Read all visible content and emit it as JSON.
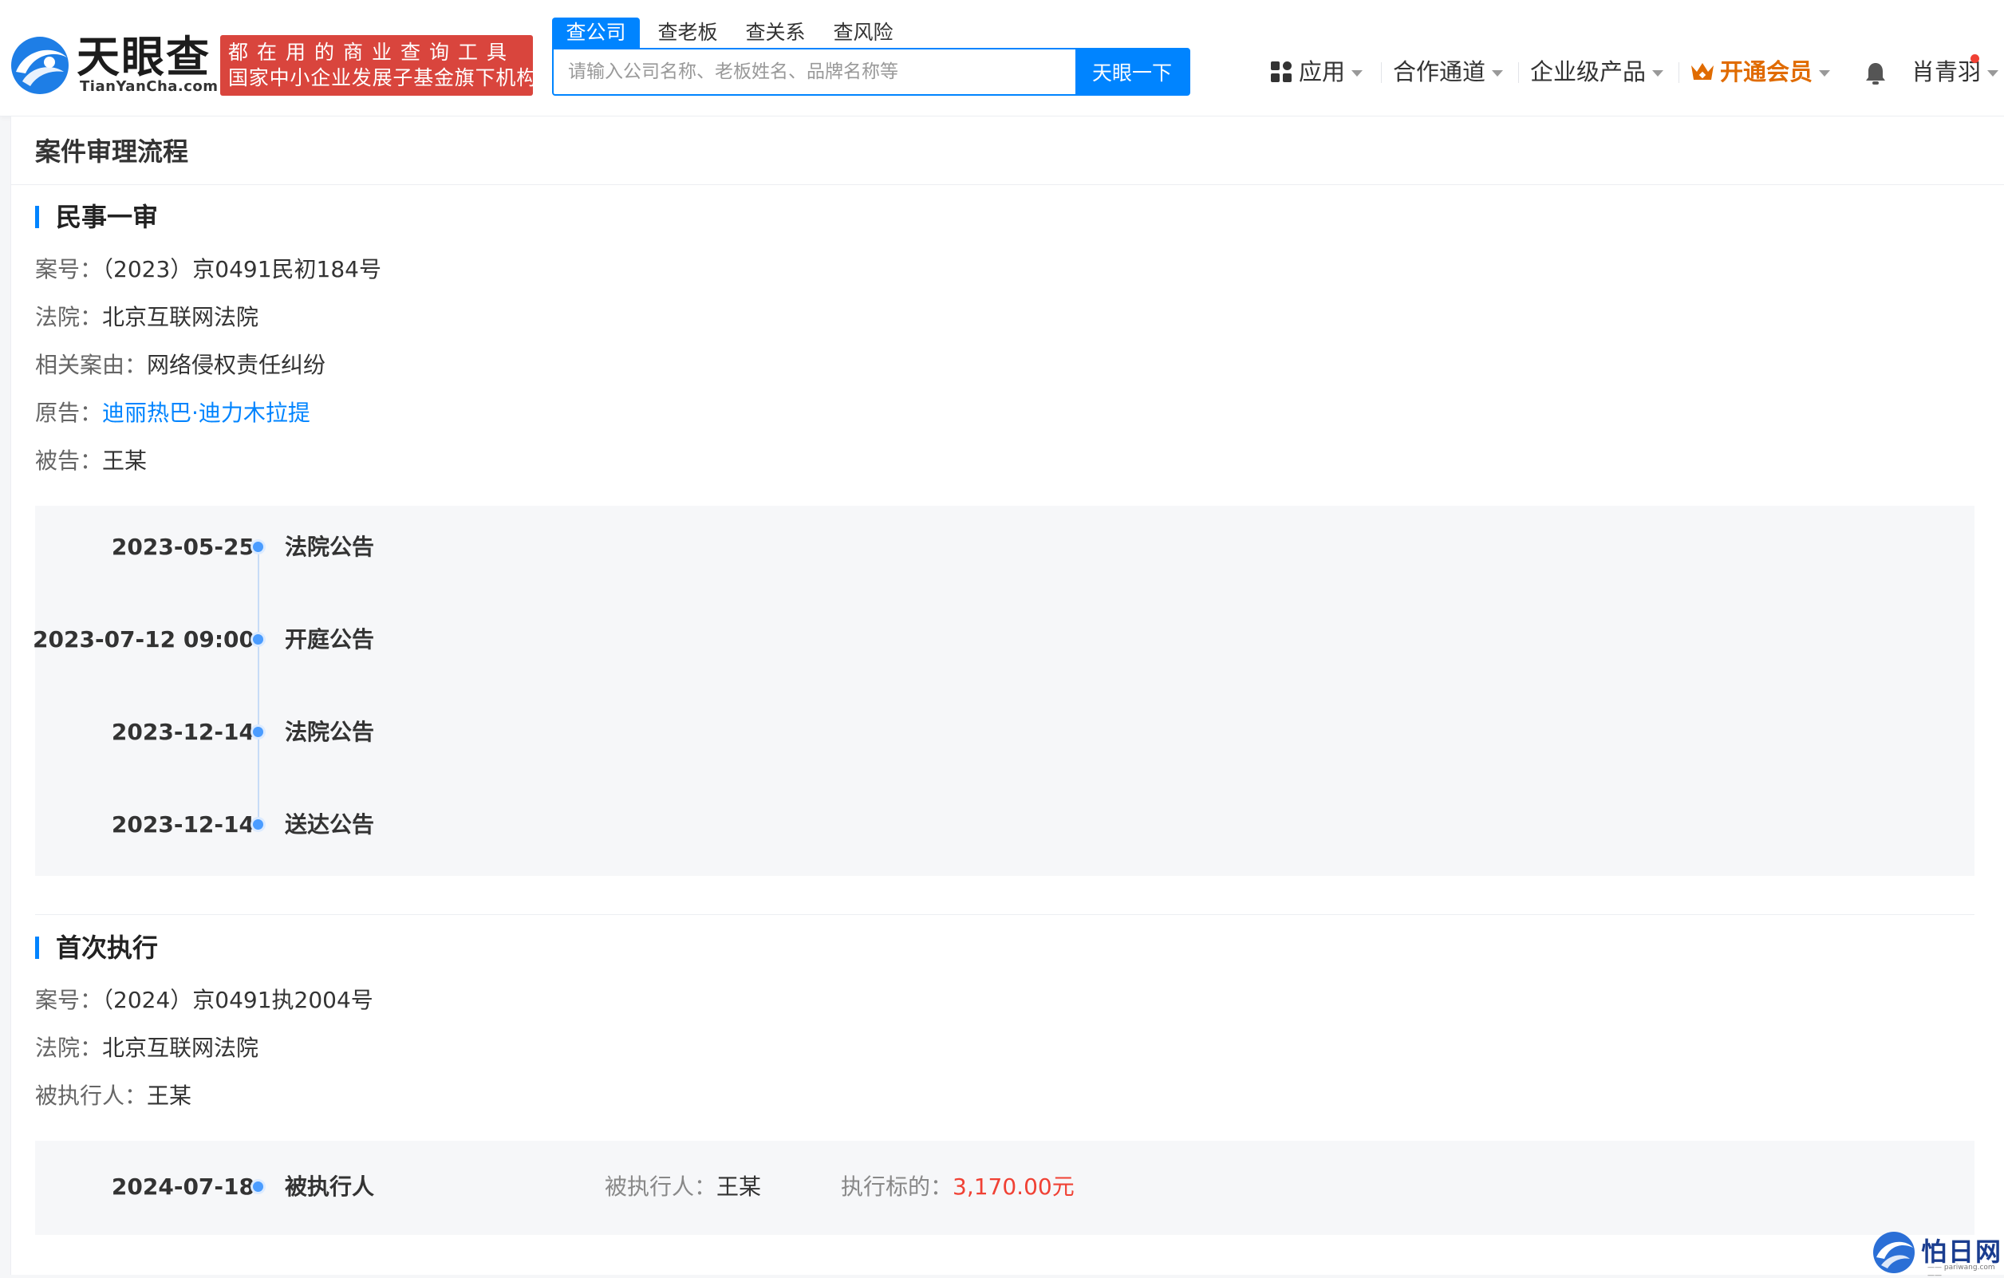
{
  "header": {
    "logo_cn": "天眼查",
    "logo_en": "TianYanCha.com",
    "slogan_line1": "都在用的商业查询工具",
    "slogan_line2": "国家中小企业发展子基金旗下机构",
    "search_tabs": [
      "查公司",
      "查老板",
      "查关系",
      "查风险"
    ],
    "search_placeholder": "请输入公司名称、老板姓名、品牌名称等",
    "search_button": "天眼一下",
    "nav": {
      "apps": "应用",
      "cooperation": "合作通道",
      "enterprise": "企业级产品",
      "vip": "开通会员",
      "user": "肖青羽"
    }
  },
  "page": {
    "title": "案件审理流程"
  },
  "civil_first_instance": {
    "title": "民事一审",
    "case_no_label": "案号：",
    "case_no": "（2023）京0491民初184号",
    "court_label": "法院：",
    "court": "北京互联网法院",
    "cause_label": "相关案由：",
    "cause": "网络侵权责任纠纷",
    "plaintiff_label": "原告：",
    "plaintiff": "迪丽热巴·迪力木拉提",
    "defendant_label": "被告：",
    "defendant": "王某",
    "timeline": [
      {
        "date": "2023-05-25",
        "event": "法院公告"
      },
      {
        "date": "2023-07-12 09:00",
        "event": "开庭公告"
      },
      {
        "date": "2023-12-14",
        "event": "法院公告"
      },
      {
        "date": "2023-12-14",
        "event": "送达公告"
      }
    ]
  },
  "first_execution": {
    "title": "首次执行",
    "case_no_label": "案号：",
    "case_no": "（2024）京0491执2004号",
    "court_label": "法院：",
    "court": "北京互联网法院",
    "executee_label": "被执行人：",
    "executee": "王某",
    "timeline": [
      {
        "date": "2024-07-18",
        "event": "被执行人",
        "executee_label": "被执行人：",
        "executee": "王某",
        "amount_label": "执行标的：",
        "amount": "3,170.00元"
      }
    ]
  },
  "watermark": {
    "text": "怕日网",
    "sub": "—— pariwang.com ——"
  },
  "colors": {
    "brand_blue": "#0084ff",
    "slogan_red": "#d9453d",
    "vip_orange": "#e06b00",
    "amount_red": "#f04134"
  }
}
